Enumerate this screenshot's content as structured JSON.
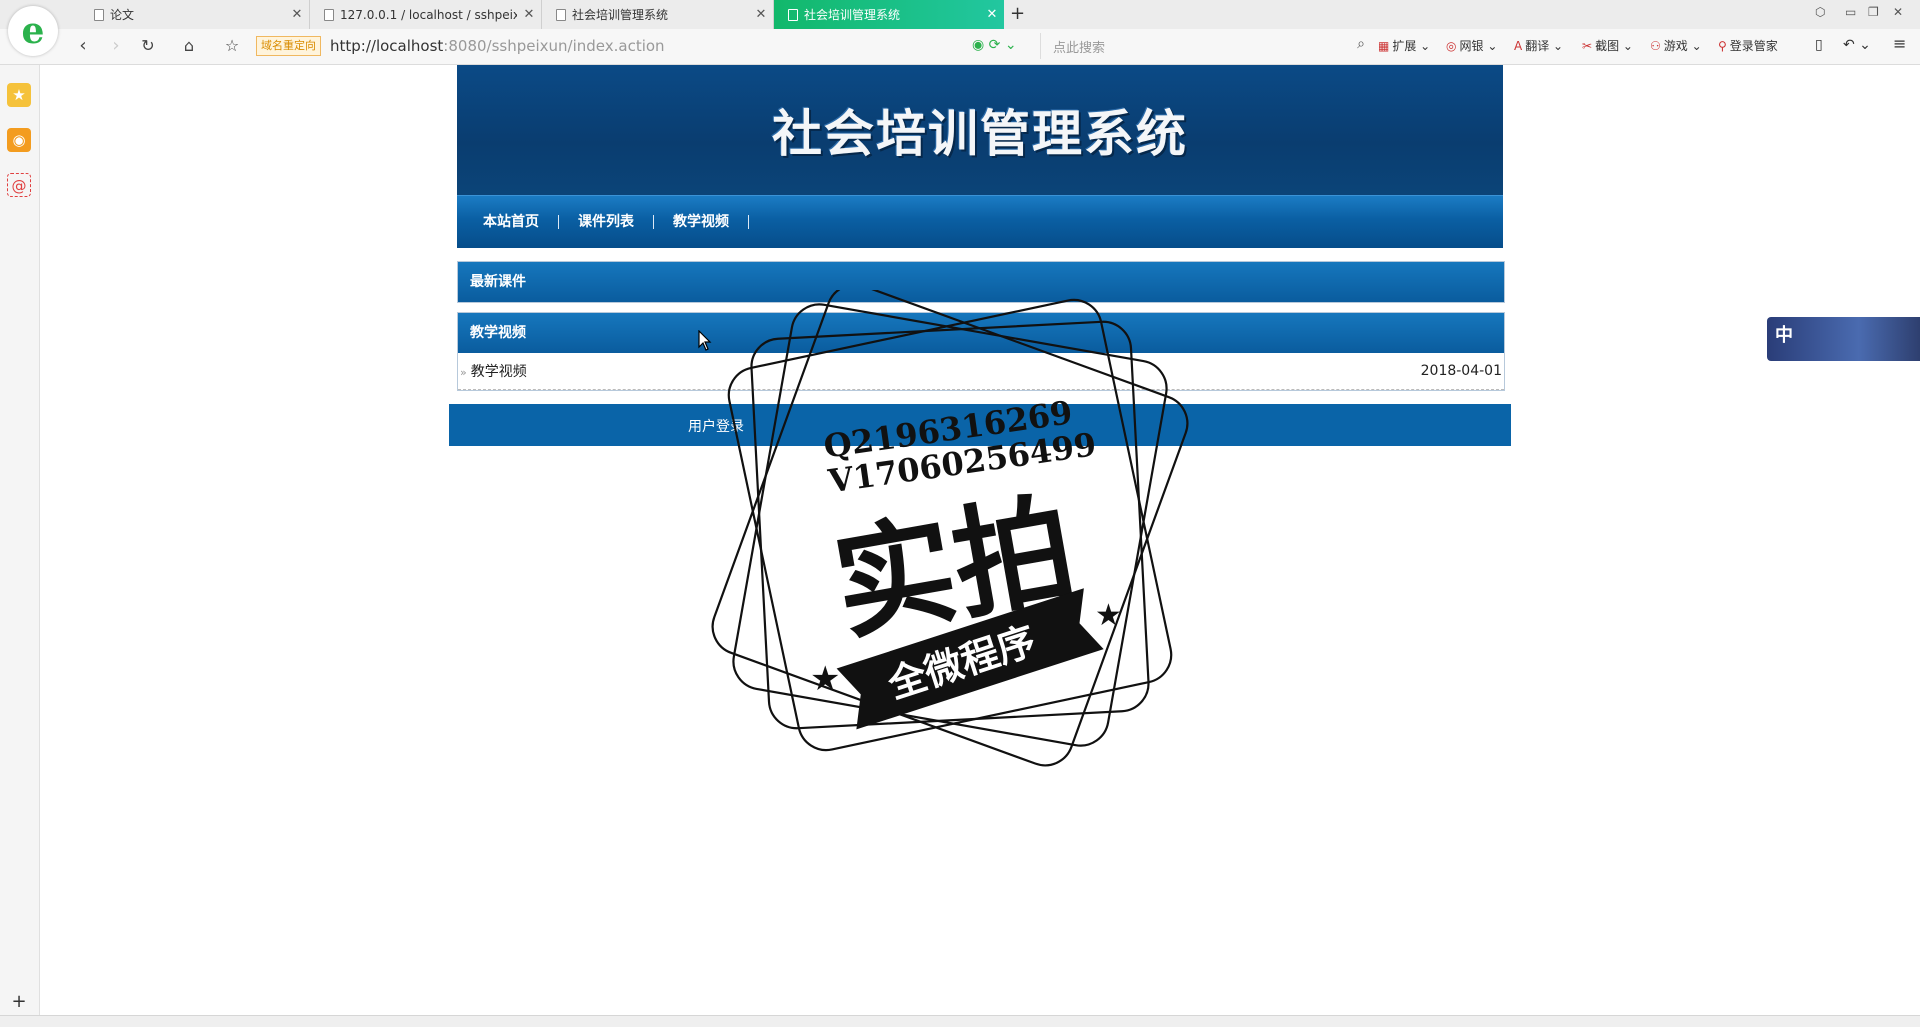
{
  "browser": {
    "tabs": [
      {
        "label": "论文"
      },
      {
        "label": "127.0.0.1 / localhost / sshpeixun"
      },
      {
        "label": "社会培训管理系统"
      },
      {
        "label": "社会培训管理系统",
        "active": true
      }
    ],
    "redirect_badge": "域名重定向",
    "url_host": "http://localhost",
    "url_rest": ":8080/sshpeixun/index.action",
    "search_placeholder": "点此搜索",
    "toolbar_items": [
      "扩展",
      "网银",
      "翻译",
      "截图",
      "游戏",
      "登录管家"
    ]
  },
  "page": {
    "site_title": "社会培训管理系统",
    "nav": [
      "本站首页",
      "课件列表",
      "教学视频"
    ],
    "latest_courseware": {
      "heading": "最新课件"
    },
    "videos": {
      "heading": "教学视频",
      "items": [
        {
          "title": "教学视频",
          "date": "2018-04-01"
        }
      ]
    },
    "login_label": "用户登录"
  },
  "float_widget": {
    "label": "中"
  },
  "watermark": {
    "line1": "Q2196316269",
    "line2": "V17060256499",
    "main": "实拍",
    "ribbon": "全微程序"
  },
  "colors": {
    "banner": "#0a3d70",
    "nav": "#0a5fa3",
    "section_head": "#1677bd",
    "tab_active": "#12b86b"
  }
}
